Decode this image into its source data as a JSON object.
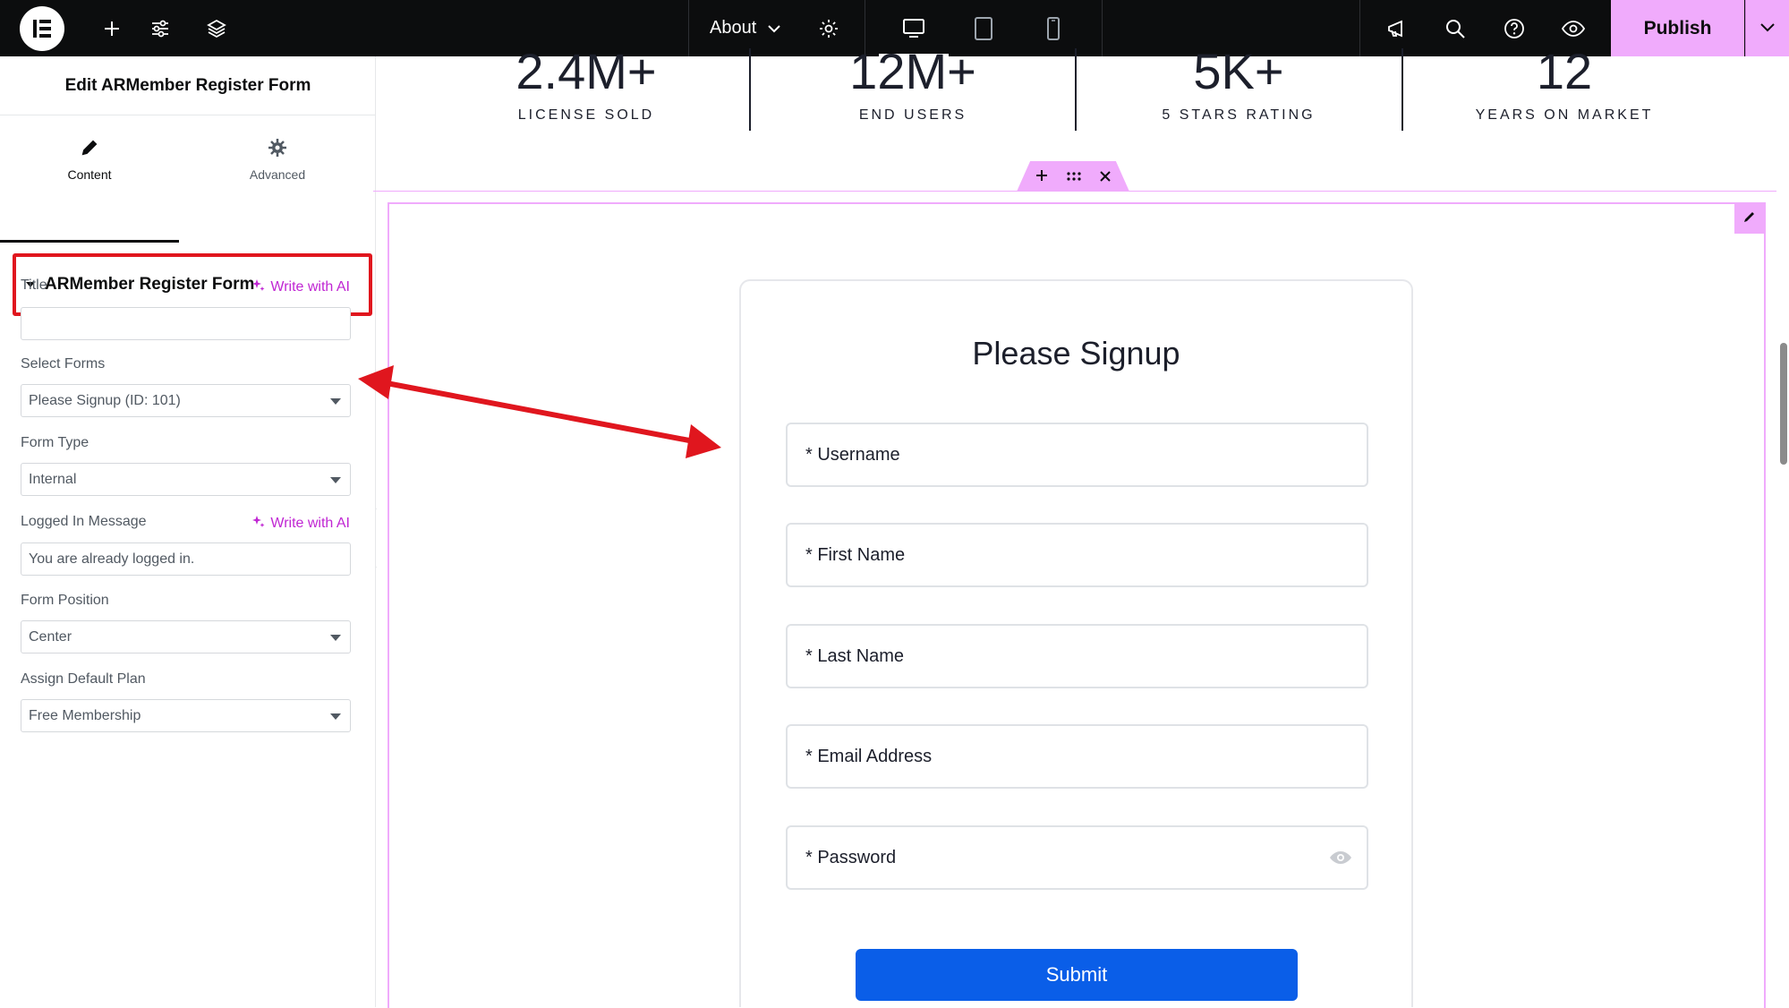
{
  "topbar": {
    "page_label": "About",
    "publish_label": "Publish"
  },
  "panel": {
    "title": "Edit ARMember Register Form",
    "tabs": [
      {
        "label": "Content"
      },
      {
        "label": "Advanced"
      }
    ],
    "section_title": "ARMember Register Form",
    "ai_label": "Write with AI",
    "controls": {
      "title_label": "Title",
      "title_value": "",
      "select_forms_label": "Select Forms",
      "select_forms_value": "Please Signup (ID: 101)",
      "form_type_label": "Form Type",
      "form_type_value": "Internal",
      "logged_in_label": "Logged In Message",
      "logged_in_value": "You are already logged in.",
      "form_position_label": "Form Position",
      "form_position_value": "Center",
      "default_plan_label": "Assign Default Plan",
      "default_plan_value": "Free Membership"
    }
  },
  "stats": [
    {
      "value": "2.4M+",
      "label": "LICENSE SOLD"
    },
    {
      "value": "12M+",
      "label": "END USERS"
    },
    {
      "value": "5K+",
      "label": "5 STARS RATING"
    },
    {
      "value": "12",
      "label": "YEARS ON MARKET"
    }
  ],
  "form": {
    "title": "Please Signup",
    "fields": [
      {
        "label": "* Username"
      },
      {
        "label": "* First Name"
      },
      {
        "label": "* Last Name"
      },
      {
        "label": "* Email Address"
      },
      {
        "label": "* Password"
      }
    ],
    "submit_label": "Submit"
  },
  "colors": {
    "topbar_bg": "#0c0d0e",
    "accent_pink": "#f0abfc",
    "ai_purple": "#c026d3",
    "highlight_red": "#e0161e",
    "submit_blue": "#0a5ee8"
  },
  "icons": [
    "elementor-logo-icon",
    "plus-icon",
    "sliders-icon",
    "layers-icon",
    "chevron-down-icon",
    "gear-icon",
    "desktop-icon",
    "tablet-icon",
    "mobile-icon",
    "notifications-icon",
    "search-icon",
    "help-icon",
    "eye-icon",
    "pencil-icon",
    "sparkle-icon",
    "caret-down-icon",
    "drag-icon",
    "close-icon",
    "collapse-icon"
  ]
}
